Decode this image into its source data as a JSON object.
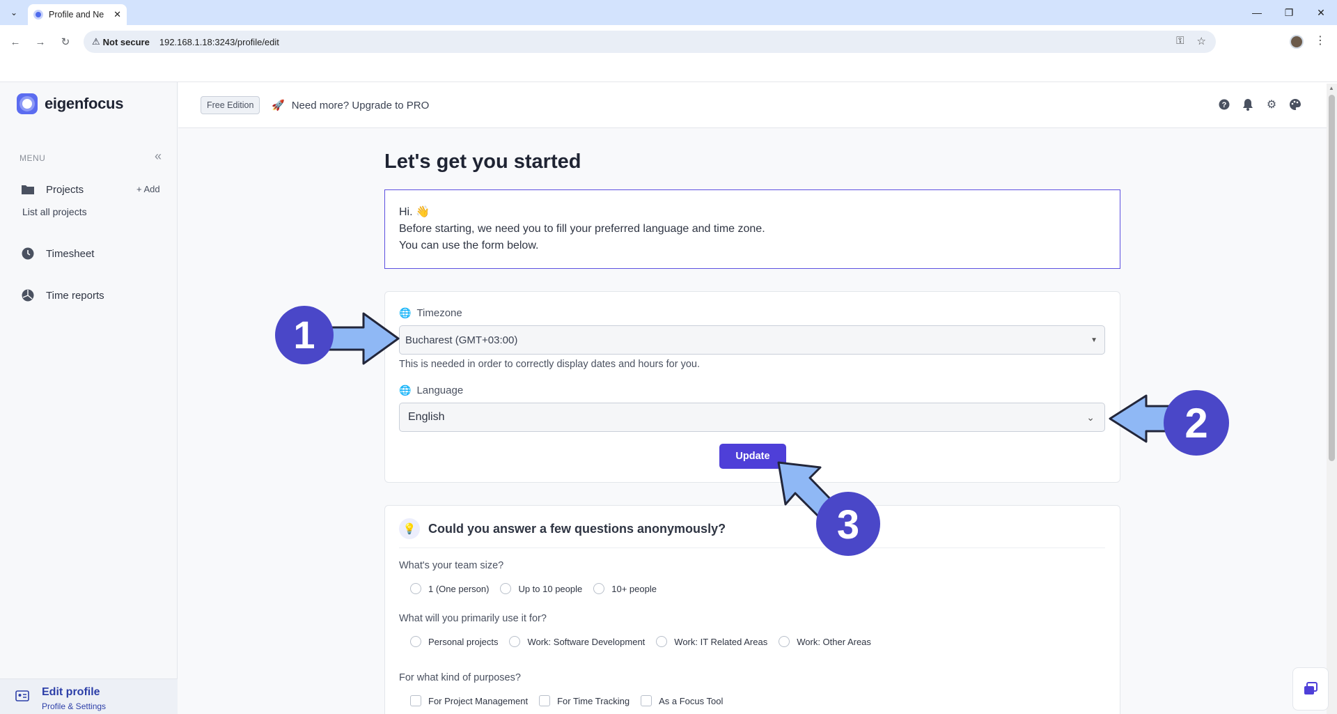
{
  "browser": {
    "tab_title": "Profile and Ne",
    "not_secure": "Not secure",
    "url": "192.168.1.18:3243/profile/edit"
  },
  "sidebar": {
    "brand": "eigenfocus",
    "menu_label": "MENU",
    "projects_label": "Projects",
    "add_label": "Add",
    "list_all_projects": "List all projects",
    "timesheet_label": "Timesheet",
    "time_reports_label": "Time reports",
    "footer_title": "Edit profile",
    "footer_subtitle": "Profile & Settings"
  },
  "header": {
    "edition_badge": "Free Edition",
    "upgrade_text": "Need more? Upgrade to PRO"
  },
  "main": {
    "title": "Let's get you started",
    "intro_line1": "Hi. 👋",
    "intro_line2": "Before starting, we need you to fill your preferred language and time zone.",
    "intro_line3": "You can use the form below.",
    "timezone_label": "Timezone",
    "timezone_value": "Bucharest (GMT+03:00)",
    "timezone_help": "This is needed in order to correctly display dates and hours for you.",
    "language_label": "Language",
    "language_value": "English",
    "update_label": "Update"
  },
  "survey": {
    "title": "Could you answer a few questions anonymously?",
    "q1": "What's your team size?",
    "q1_options": [
      "1 (One person)",
      "Up to 10 people",
      "10+ people"
    ],
    "q2": "What will you primarily use it for?",
    "q2_options": [
      "Personal projects",
      "Work: Software Development",
      "Work: IT Related Areas",
      "Work: Other Areas"
    ],
    "q3": "For what kind of purposes?",
    "q3_options": [
      "For Project Management",
      "For Time Tracking",
      "As a Focus Tool"
    ]
  },
  "annotations": {
    "step1": "1",
    "step2": "2",
    "step3": "3",
    "color": "#4a47c8",
    "arrow_color": "#8fb8f5"
  }
}
